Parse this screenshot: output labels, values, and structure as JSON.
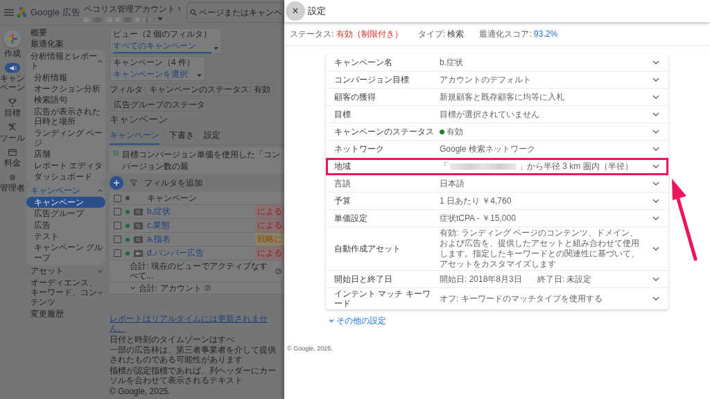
{
  "topbar": {
    "product": "Google 広告",
    "account": "ペコリス管理アカウント",
    "account_arrow": "›",
    "search_placeholder": "ページまたはキャンペ"
  },
  "rail": [
    {
      "label": "作成",
      "kind": "create"
    },
    {
      "label": "キャンペーン",
      "kind": "campaign",
      "selected": true
    },
    {
      "label": "目標",
      "kind": "goal",
      "selected": false
    },
    {
      "label": "ツール",
      "kind": "tools",
      "selected": false
    },
    {
      "label": "料金",
      "kind": "billing",
      "selected": false
    },
    {
      "label": "管理者",
      "kind": "admin",
      "selected": false
    }
  ],
  "nav": [
    {
      "label": "概要",
      "kind": "link",
      "selected": false
    },
    {
      "label": "最適化案",
      "kind": "link",
      "selected": false
    },
    {
      "label": "分析情報とレポート",
      "kind": "section",
      "expanded": true,
      "children": [
        {
          "label": "分析情報",
          "selected": false
        },
        {
          "label": "オークション分析",
          "selected": false
        },
        {
          "label": "検索語句",
          "selected": false
        },
        {
          "label": "広告が表示された日時と場所",
          "selected": false
        },
        {
          "label": "ランディング ページ",
          "selected": false
        },
        {
          "label": "店舗",
          "selected": false
        },
        {
          "label": "レポート エディタ",
          "selected": false
        },
        {
          "label": "ダッシュボード",
          "selected": false
        }
      ]
    },
    {
      "label": "キャンペーン",
      "kind": "section",
      "expanded": true,
      "children": [
        {
          "label": "キャンペーン",
          "selected": true
        },
        {
          "label": "広告グループ",
          "selected": false
        },
        {
          "label": "広告",
          "selected": false
        },
        {
          "label": "テスト",
          "selected": false
        },
        {
          "label": "キャンペーン グループ",
          "selected": false
        }
      ]
    },
    {
      "label": "アセット",
      "kind": "section",
      "expanded": false
    },
    {
      "label": "オーディエンス、キーワード、コンテンツ",
      "kind": "section",
      "expanded": false
    },
    {
      "label": "変更履歴",
      "kind": "link",
      "selected": false
    }
  ],
  "main": {
    "selectors": [
      {
        "label": "ビュー（2 個のフィルタ）",
        "value": "すべてのキャンペーン",
        "kind": "view"
      },
      {
        "label": "キャンペーン（4 件）",
        "value": "キャンペーンを選択",
        "kind": "campaign"
      }
    ],
    "filter_label": "フィルタ",
    "filter_chips": [
      "キャンペーンのステータス: 有効",
      "広告グループのステータ"
    ],
    "title": "キャンペーン",
    "tabs": [
      {
        "label": "キャンペーン",
        "selected": true
      },
      {
        "label": "下書き",
        "selected": false
      },
      {
        "label": "設定",
        "selected": false
      }
    ],
    "banner": "目標コンバージョン単価を使用した「コンバージョン数の最",
    "add_filter": "フィルタを追加",
    "table": {
      "header": "キャンペーン",
      "header_checked": false,
      "rows": [
        {
          "name": "b.症状",
          "kind": "search",
          "checked": false,
          "active": true,
          "tag": {
            "text": "による",
            "kind": "error"
          }
        },
        {
          "name": "c.業態",
          "kind": "search",
          "checked": false,
          "active": true,
          "tag": {
            "text": "による",
            "kind": "error"
          }
        },
        {
          "name": "a.指名",
          "kind": "search",
          "checked": false,
          "active": true,
          "tag": {
            "text": "戦略に",
            "kind": "warning"
          }
        },
        {
          "name": "d.バンパー広告",
          "kind": "video",
          "checked": false,
          "active": true,
          "tag": {
            "text": "による",
            "kind": "error"
          }
        }
      ],
      "totals": [
        "合計: 現在のビューでアクティブなすべて...",
        "合計: アカウント"
      ]
    },
    "footer": {
      "link": "レポートはリアルタイムには更新されません。",
      "text": "日付と時刻のタイムゾーンはすべ",
      "lines": [
        "一部の広告枠は、第三者事業者を介して提供されたものである可能性があります",
        "指標が認定指標であれば、列ヘッダーにカーソルを合わせて表示されるテキスト"
      ],
      "copyright": "© Google, 2025."
    }
  },
  "panel": {
    "close_label": "×",
    "title": "設定",
    "status": [
      {
        "label": "ステータス:",
        "value": "有効（制限付き）",
        "kind": "error"
      },
      {
        "label": "タイプ:",
        "value": "検索",
        "kind": "plain"
      },
      {
        "label": "最適化スコア:",
        "value": "93.2%",
        "kind": "link"
      }
    ],
    "rows": [
      {
        "label": "キャンペーン名",
        "kind": "text",
        "value": "b.症状",
        "highlighted": false
      },
      {
        "label": "コンバージョン目標",
        "kind": "text",
        "value": "アカウントのデフォルト",
        "highlighted": false
      },
      {
        "label": "顧客の獲得",
        "kind": "text",
        "value": "新規顧客と既存顧客に均等に入札",
        "highlighted": false
      },
      {
        "label": "目標",
        "kind": "text",
        "value": "目標が選択されていません",
        "highlighted": false
      },
      {
        "label": "キャンペーンのステータス",
        "kind": "status",
        "value": "有効",
        "color": "#188038",
        "highlighted": false
      },
      {
        "label": "ネットワーク",
        "kind": "text",
        "value": "Google 検索ネットワーク",
        "highlighted": false
      },
      {
        "label": "地域",
        "kind": "location",
        "prefix": "「",
        "value": "」から半径 3 km 圏内（半径）",
        "highlighted": true
      },
      {
        "label": "言語",
        "kind": "text",
        "value": "日本語",
        "highlighted": false
      },
      {
        "label": "予算",
        "kind": "text",
        "value": "1 日あたり ￥4,760",
        "highlighted": false
      },
      {
        "label": "単価設定",
        "kind": "text",
        "value": "症状tCPA - ￥15,000",
        "highlighted": false
      },
      {
        "label": "自動作成アセット",
        "kind": "text",
        "value": "有効: ランディング ページのコンテンツ、ドメイン、および広告を、提供したアセットと組み合わせて使用します。指定したキーワードとの関連性に基づいて、アセットをカスタマイズします",
        "highlighted": false
      },
      {
        "label": "開始日と終了日",
        "kind": "dates",
        "value": "開始日: 2018年8月3日",
        "value_2": "終了日: 未設定",
        "highlighted": false
      },
      {
        "label": "インテント マッチ キーワード",
        "kind": "text",
        "value": "オフ: キーワードのマッチタイプを使用する",
        "highlighted": false
      }
    ],
    "more_link": "その他の設定",
    "copyright": "© Google, 2025."
  }
}
